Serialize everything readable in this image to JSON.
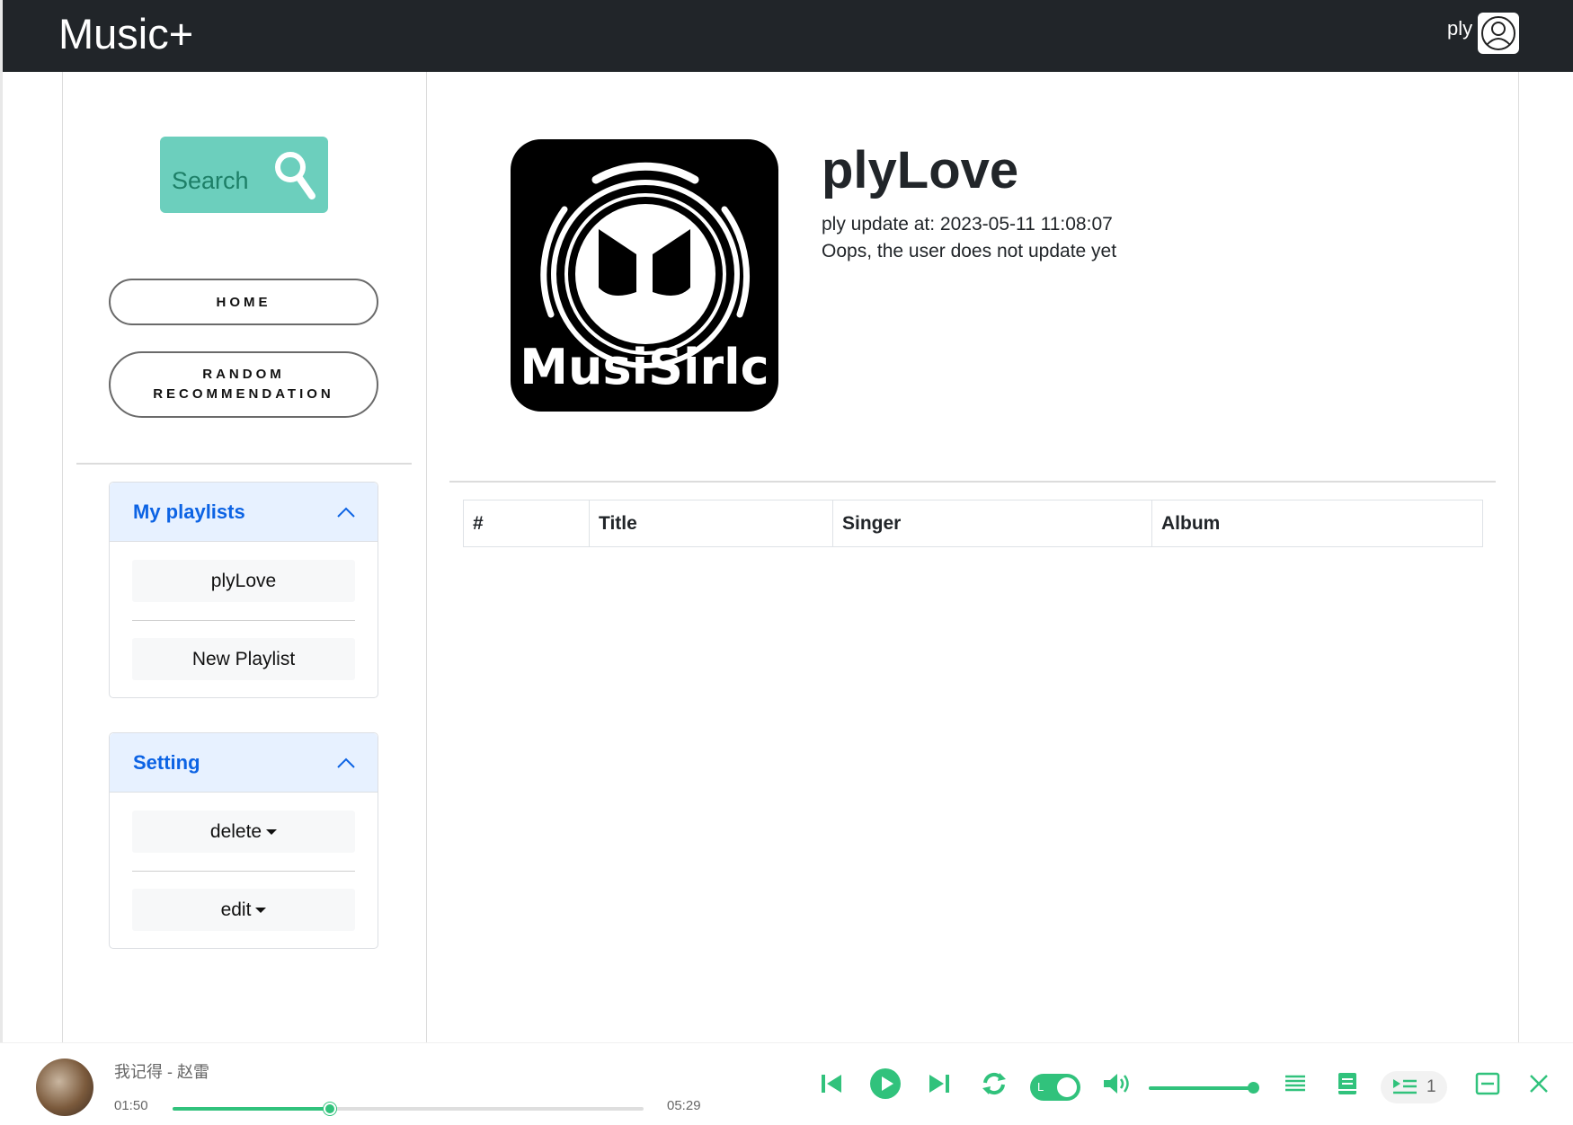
{
  "app": {
    "title": "Music+",
    "user_name": "ply"
  },
  "sidebar": {
    "search_label": "Search",
    "nav": {
      "home": "HOME",
      "random_line1": "RANDOM",
      "random_line2": "RECOMMENDATION"
    },
    "playlists": {
      "header": "My playlists",
      "items": [
        "plyLove",
        "New Playlist"
      ]
    },
    "setting": {
      "header": "Setting",
      "items": [
        "delete",
        "edit"
      ]
    }
  },
  "playlist": {
    "name": "plyLove",
    "cover_text": "MusiSirlc",
    "updated": "ply update at: 2023-05-11 11:08:07",
    "description": "Oops, the user does not update yet"
  },
  "table": {
    "headers": [
      "#",
      "Title",
      "Singer",
      "Album"
    ]
  },
  "player": {
    "track": "我记得 - 赵雷",
    "current_time": "01:50",
    "total_time": "05:29",
    "progress": 0.334,
    "volume": 0.96,
    "mode_toggle_label": "L",
    "queue_count": "1",
    "accent_color": "#31c27c"
  }
}
